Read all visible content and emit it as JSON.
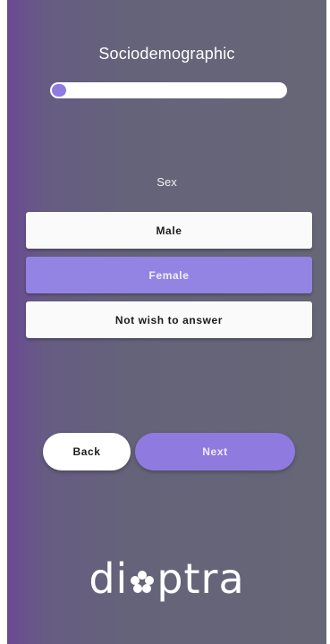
{
  "header": {
    "title": "Sociodemographic"
  },
  "progress": {
    "value_fraction": 0.06
  },
  "question": {
    "label": "Sex",
    "options": [
      {
        "label": "Male",
        "selected": false
      },
      {
        "label": "Female",
        "selected": true
      },
      {
        "label": "Not wish to answer",
        "selected": false
      }
    ]
  },
  "navigation": {
    "back_label": "Back",
    "next_label": "Next"
  },
  "brand": {
    "logo_text": "dioptra",
    "accent_color": "#8f7be0"
  }
}
